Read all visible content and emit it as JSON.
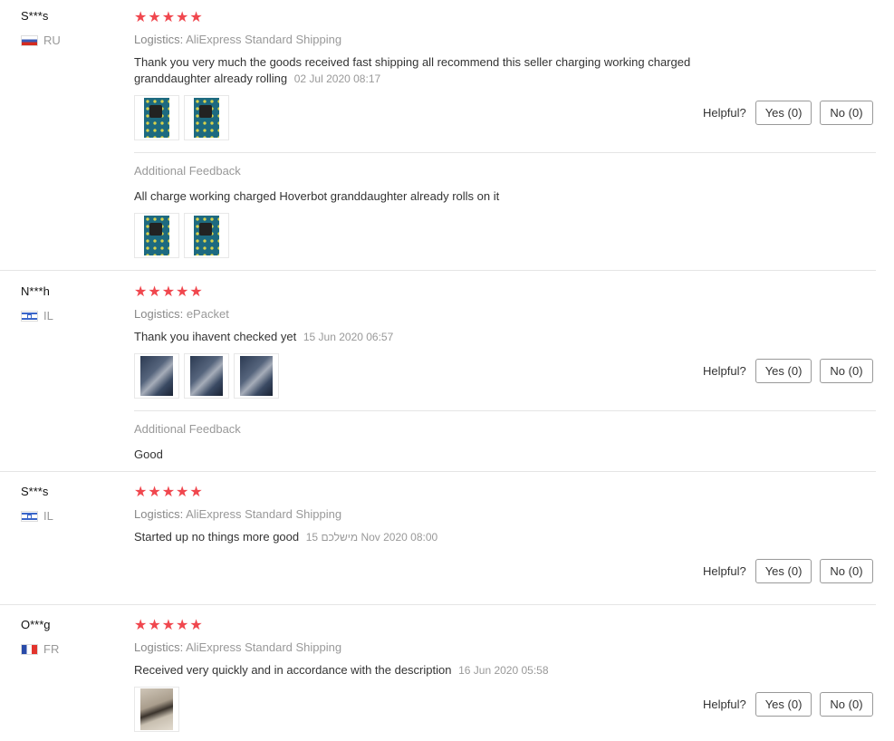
{
  "reviews": [
    {
      "user": "S***s",
      "country": "RU",
      "flag": "ru",
      "logistics_label": "Logistics:",
      "logistics": "AliExpress Standard Shipping",
      "text": "Thank you very much the goods received fast shipping all recommend this seller charging working charged granddaughter already rolling",
      "date": "02 Jul 2020 08:17",
      "photo_count": 2,
      "helpful_label": "Helpful?",
      "yes": "Yes (0)",
      "no": "No (0)",
      "additional_title": "Additional Feedback",
      "additional_text": "All charge working charged Hoverbot granddaughter already rolls on it",
      "additional_photo_count": 2
    },
    {
      "user": "N***h",
      "country": "IL",
      "flag": "il",
      "logistics_label": "Logistics:",
      "logistics": "ePacket",
      "text": "Thank you ihavent checked yet",
      "date": "15 Jun 2020 06:57",
      "photo_count": 3,
      "helpful_label": "Helpful?",
      "yes": "Yes (0)",
      "no": "No (0)",
      "additional_title": "Additional Feedback",
      "additional_text": "Good"
    },
    {
      "user": "S***s",
      "country": "IL",
      "flag": "il",
      "logistics_label": "Logistics:",
      "logistics": "AliExpress Standard Shipping",
      "text": "Started up no things more good",
      "date": "15 מישלכם Nov 2020 08:00",
      "helpful_label": "Helpful?",
      "yes": "Yes (0)",
      "no": "No (0)"
    },
    {
      "user": "O***g",
      "country": "FR",
      "flag": "fr",
      "logistics_label": "Logistics:",
      "logistics": "AliExpress Standard Shipping",
      "text": "Received very quickly and in accordance with the description",
      "date": "16 Jun 2020 05:58",
      "photo_count": 1,
      "helpful_label": "Helpful?",
      "yes": "Yes (0)",
      "no": "No (0)"
    }
  ],
  "rating": 5,
  "colors": {
    "star": "#f0474e",
    "muted": "#999999",
    "divider": "#e5e5e5"
  },
  "icons": {
    "star": "star-icon",
    "flag_ru": "russia-flag-icon",
    "flag_il": "israel-flag-icon",
    "flag_fr": "france-flag-icon"
  }
}
